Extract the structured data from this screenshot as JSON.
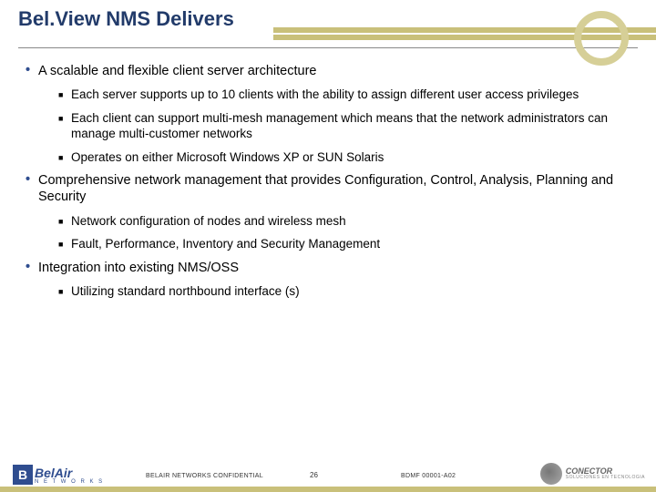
{
  "slide": {
    "title": "Bel.View NMS Delivers",
    "bullets": [
      {
        "text": "A scalable and flexible client server architecture",
        "sub": [
          "Each server supports up to 10 clients with the ability to assign different user access privileges",
          "Each client can support multi-mesh management which means that the network administrators can manage multi-customer networks",
          "Operates on either Microsoft Windows XP or SUN Solaris"
        ]
      },
      {
        "text": "Comprehensive network management that provides Configuration, Control, Analysis, Planning and Security",
        "sub": [
          "Network configuration of nodes and wireless mesh",
          "Fault, Performance, Inventory and Security Management"
        ]
      },
      {
        "text": "Integration into existing NMS/OSS",
        "sub": [
          "Utilizing standard northbound interface (s)"
        ]
      }
    ]
  },
  "footer": {
    "logo_left_initial": "B",
    "logo_left_brand": "BelAir",
    "logo_left_sub": "N E T W O R K S",
    "confidential": "BELAIR NETWORKS CONFIDENTIAL",
    "page": "26",
    "docid": "BDMF 00001-A02",
    "logo_right_brand": "CONECTOR",
    "logo_right_sub": "SOLUCIONES EN TECNOLOGIA"
  }
}
